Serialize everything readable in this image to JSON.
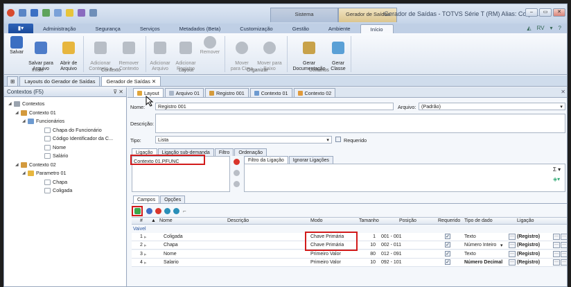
{
  "title_bar": {
    "context_tabs": [
      "Sistema",
      "Gerador de Saídas"
    ],
    "window_title": "Gerador de Saídas - TOTVS Série T  (RM) Alias: Corpor...",
    "window_buttons": [
      "–",
      "▭",
      "✕"
    ]
  },
  "ribbon_tabs": [
    "Administração",
    "Segurança",
    "Serviços",
    "Metadados (Beta)",
    "Customização",
    "Gestão",
    "Ambiente",
    "Início"
  ],
  "ribbon_right_icons": [
    "◭",
    "RV",
    "▾",
    "?"
  ],
  "ribbon": {
    "buttons": [
      {
        "label": "Salvar",
        "enabled": true
      },
      {
        "label": "Salvar para\nArquivo",
        "enabled": true
      },
      {
        "label": "Abrir de\nArquivo",
        "enabled": true
      },
      {
        "label": "Adicionar\nContexto ▾",
        "enabled": false
      },
      {
        "label": "Remover\nContexto",
        "enabled": false
      },
      {
        "label": "Adicionar\nArquivo",
        "enabled": false
      },
      {
        "label": "Adicionar\nRegistro",
        "enabled": false
      },
      {
        "label": "Remover",
        "enabled": false
      },
      {
        "label": "Mover\npara Cima",
        "enabled": false
      },
      {
        "label": "Mover para\nBaixo",
        "enabled": false
      },
      {
        "label": "Gerar\nDocumentação",
        "enabled": true
      },
      {
        "label": "Gerar\nClasse",
        "enabled": true
      }
    ],
    "groups": [
      "Início",
      "Contexto",
      "Layout",
      "Organizar",
      "Utilitários"
    ]
  },
  "doc_tabs": [
    "Layouts do Gerador de Saídas",
    "Gerador de Saídas ✕"
  ],
  "left_panel": {
    "title": "Contextos (F5)",
    "controls": "⊽ ✕",
    "tree": [
      {
        "label": "Contextos",
        "icon": "contexts-icon"
      },
      {
        "label": "Contexto 01",
        "icon": "context-icon"
      },
      {
        "label": "Funcionários",
        "icon": "table-icon"
      },
      {
        "label": "Chapa do Funcionário",
        "icon": "field-icon"
      },
      {
        "label": "Código Identificador da C...",
        "icon": "field-icon"
      },
      {
        "label": "Nome",
        "icon": "field-icon"
      },
      {
        "label": "Salário",
        "icon": "field-icon"
      },
      {
        "label": "Contexto 02",
        "icon": "context-icon"
      },
      {
        "label": "Parametro 01",
        "icon": "folder-icon"
      },
      {
        "label": "Chapa",
        "icon": "field-icon"
      },
      {
        "label": "Coligada",
        "icon": "field-icon"
      }
    ]
  },
  "editor": {
    "tabs": [
      "Layout",
      "Arquivo 01",
      "Registro 001",
      "Contexto 01",
      "Contexto 02"
    ],
    "nome_label": "Nome:",
    "nome_value": "Registro 001",
    "arquivo_label": "Arquivo:",
    "arquivo_value": "(Padrão)",
    "descricao_label": "Descrição:",
    "tipo_label": "Tipo:",
    "tipo_value": "Lista",
    "requerido_label": "Requerido",
    "sub_tabs": [
      "Ligação",
      "Ligação sub-demanda",
      "Filtro",
      "Ordenação"
    ],
    "ligacao_item": "Contexto 01.PFUNC",
    "filter_tabs": [
      "Filtro da Ligação",
      "Ignorar Ligações"
    ],
    "sigma_button": "Σ ▾",
    "bottom_tabs": [
      "Campos",
      "Opções"
    ],
    "grid_header": [
      "#",
      "▲",
      "Nome",
      "Descrição",
      "Modo",
      "Tamanho",
      "Posição",
      "Requerido",
      "Tipo de dado",
      "Ligação"
    ],
    "group_label": "Vaivel",
    "rows": [
      {
        "num": "1",
        "name": "Coligada",
        "desc": "",
        "mode": "Chave Primária",
        "size": "1",
        "pos": "001 - 001",
        "req": true,
        "type": "Texto",
        "lig": "(Registro)"
      },
      {
        "num": "2",
        "name": "Chapa",
        "desc": "",
        "mode": "Chave Primária",
        "size": "10",
        "pos": "002 - 011",
        "req": true,
        "type": "Número Inteiro",
        "lig": "(Registro)"
      },
      {
        "num": "3",
        "name": "Nome",
        "desc": "",
        "mode": "Primeiro Valor",
        "size": "80",
        "pos": "012 - 091",
        "req": true,
        "type": "Texto",
        "lig": "(Registro)"
      },
      {
        "num": "4",
        "name": "Salario",
        "desc": "",
        "mode": "Primeiro Valor",
        "size": "10",
        "pos": "092 - 101",
        "req": true,
        "type": "Número Decimal",
        "lig": "(Registro)"
      }
    ]
  },
  "colors": {
    "highlight_box": "#d21a1a",
    "ribbon_accent": "#1b4b9a"
  }
}
